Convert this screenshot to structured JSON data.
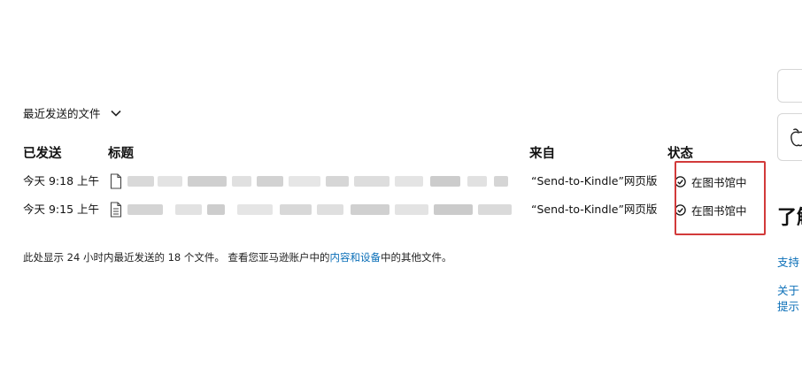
{
  "recent": {
    "dropdown_label": "最近发送的文件"
  },
  "table": {
    "columns": {
      "sent": "已发送",
      "title": "标题",
      "source": "来自",
      "status": "状态"
    },
    "rows": [
      {
        "sent": "今天 9:18 上午",
        "title": "",
        "source": "“Send-to-Kindle”网页版",
        "status": "在图书馆中"
      },
      {
        "sent": "今天 9:15 上午",
        "title": "",
        "source": "“Send-to-Kindle”网页版",
        "status": "在图书馆中"
      }
    ]
  },
  "footer": {
    "text_before": "此处显示 24 小时内最近发送的 18 个文件。 查看您亚马逊账户中的",
    "link_label": "内容和设备",
    "text_after": "中的其他文件。"
  },
  "sidebar": {
    "title": "了解",
    "links": [
      "支持",
      "关于",
      "提示"
    ]
  },
  "colors": {
    "highlight_border": "#d23a3a",
    "link": "#0b6fb8"
  }
}
